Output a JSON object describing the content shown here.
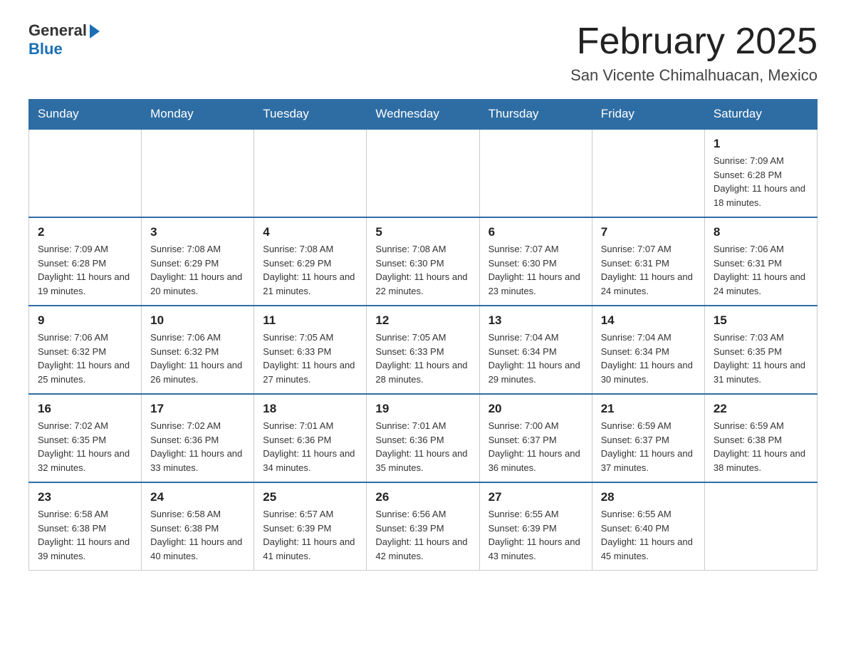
{
  "header": {
    "logo_general": "General",
    "logo_blue": "Blue",
    "title": "February 2025",
    "location": "San Vicente Chimalhuacan, Mexico"
  },
  "days_of_week": [
    "Sunday",
    "Monday",
    "Tuesday",
    "Wednesday",
    "Thursday",
    "Friday",
    "Saturday"
  ],
  "weeks": [
    [
      {
        "day": "",
        "info": ""
      },
      {
        "day": "",
        "info": ""
      },
      {
        "day": "",
        "info": ""
      },
      {
        "day": "",
        "info": ""
      },
      {
        "day": "",
        "info": ""
      },
      {
        "day": "",
        "info": ""
      },
      {
        "day": "1",
        "info": "Sunrise: 7:09 AM\nSunset: 6:28 PM\nDaylight: 11 hours and 18 minutes."
      }
    ],
    [
      {
        "day": "2",
        "info": "Sunrise: 7:09 AM\nSunset: 6:28 PM\nDaylight: 11 hours and 19 minutes."
      },
      {
        "day": "3",
        "info": "Sunrise: 7:08 AM\nSunset: 6:29 PM\nDaylight: 11 hours and 20 minutes."
      },
      {
        "day": "4",
        "info": "Sunrise: 7:08 AM\nSunset: 6:29 PM\nDaylight: 11 hours and 21 minutes."
      },
      {
        "day": "5",
        "info": "Sunrise: 7:08 AM\nSunset: 6:30 PM\nDaylight: 11 hours and 22 minutes."
      },
      {
        "day": "6",
        "info": "Sunrise: 7:07 AM\nSunset: 6:30 PM\nDaylight: 11 hours and 23 minutes."
      },
      {
        "day": "7",
        "info": "Sunrise: 7:07 AM\nSunset: 6:31 PM\nDaylight: 11 hours and 24 minutes."
      },
      {
        "day": "8",
        "info": "Sunrise: 7:06 AM\nSunset: 6:31 PM\nDaylight: 11 hours and 24 minutes."
      }
    ],
    [
      {
        "day": "9",
        "info": "Sunrise: 7:06 AM\nSunset: 6:32 PM\nDaylight: 11 hours and 25 minutes."
      },
      {
        "day": "10",
        "info": "Sunrise: 7:06 AM\nSunset: 6:32 PM\nDaylight: 11 hours and 26 minutes."
      },
      {
        "day": "11",
        "info": "Sunrise: 7:05 AM\nSunset: 6:33 PM\nDaylight: 11 hours and 27 minutes."
      },
      {
        "day": "12",
        "info": "Sunrise: 7:05 AM\nSunset: 6:33 PM\nDaylight: 11 hours and 28 minutes."
      },
      {
        "day": "13",
        "info": "Sunrise: 7:04 AM\nSunset: 6:34 PM\nDaylight: 11 hours and 29 minutes."
      },
      {
        "day": "14",
        "info": "Sunrise: 7:04 AM\nSunset: 6:34 PM\nDaylight: 11 hours and 30 minutes."
      },
      {
        "day": "15",
        "info": "Sunrise: 7:03 AM\nSunset: 6:35 PM\nDaylight: 11 hours and 31 minutes."
      }
    ],
    [
      {
        "day": "16",
        "info": "Sunrise: 7:02 AM\nSunset: 6:35 PM\nDaylight: 11 hours and 32 minutes."
      },
      {
        "day": "17",
        "info": "Sunrise: 7:02 AM\nSunset: 6:36 PM\nDaylight: 11 hours and 33 minutes."
      },
      {
        "day": "18",
        "info": "Sunrise: 7:01 AM\nSunset: 6:36 PM\nDaylight: 11 hours and 34 minutes."
      },
      {
        "day": "19",
        "info": "Sunrise: 7:01 AM\nSunset: 6:36 PM\nDaylight: 11 hours and 35 minutes."
      },
      {
        "day": "20",
        "info": "Sunrise: 7:00 AM\nSunset: 6:37 PM\nDaylight: 11 hours and 36 minutes."
      },
      {
        "day": "21",
        "info": "Sunrise: 6:59 AM\nSunset: 6:37 PM\nDaylight: 11 hours and 37 minutes."
      },
      {
        "day": "22",
        "info": "Sunrise: 6:59 AM\nSunset: 6:38 PM\nDaylight: 11 hours and 38 minutes."
      }
    ],
    [
      {
        "day": "23",
        "info": "Sunrise: 6:58 AM\nSunset: 6:38 PM\nDaylight: 11 hours and 39 minutes."
      },
      {
        "day": "24",
        "info": "Sunrise: 6:58 AM\nSunset: 6:38 PM\nDaylight: 11 hours and 40 minutes."
      },
      {
        "day": "25",
        "info": "Sunrise: 6:57 AM\nSunset: 6:39 PM\nDaylight: 11 hours and 41 minutes."
      },
      {
        "day": "26",
        "info": "Sunrise: 6:56 AM\nSunset: 6:39 PM\nDaylight: 11 hours and 42 minutes."
      },
      {
        "day": "27",
        "info": "Sunrise: 6:55 AM\nSunset: 6:39 PM\nDaylight: 11 hours and 43 minutes."
      },
      {
        "day": "28",
        "info": "Sunrise: 6:55 AM\nSunset: 6:40 PM\nDaylight: 11 hours and 45 minutes."
      },
      {
        "day": "",
        "info": ""
      }
    ]
  ]
}
